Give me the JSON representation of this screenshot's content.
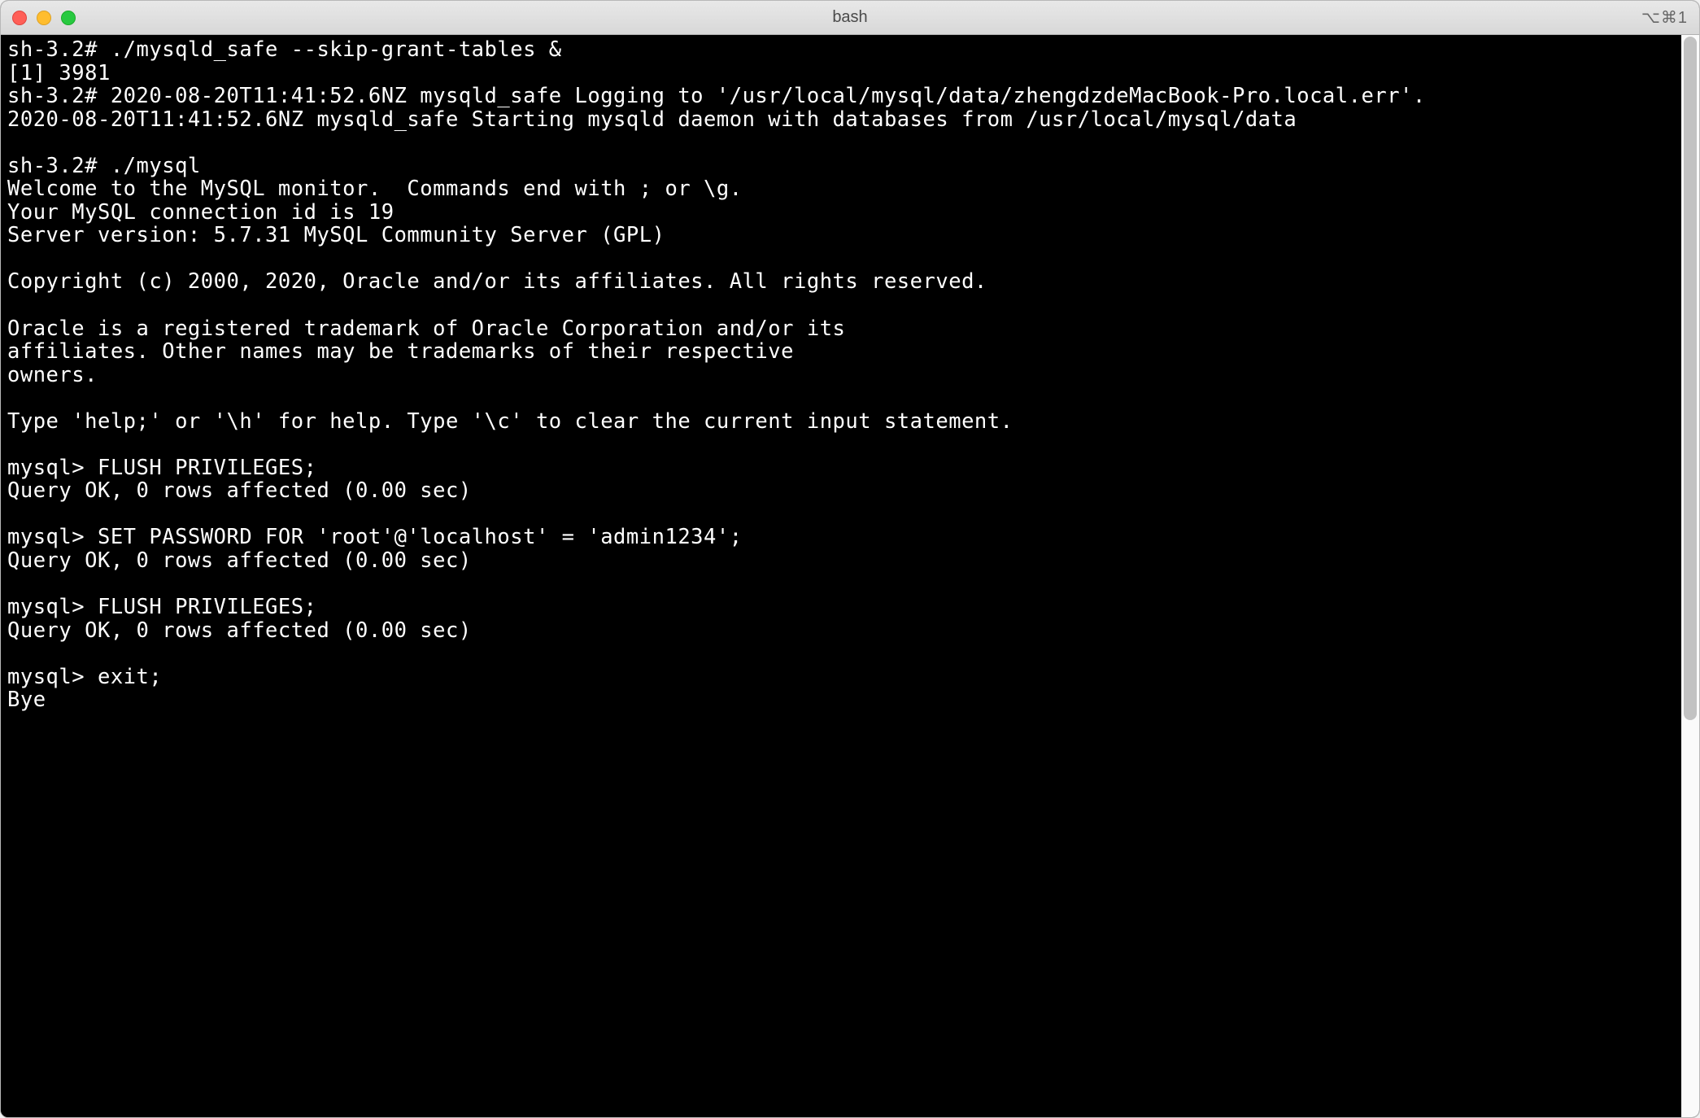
{
  "titlebar": {
    "title": "bash",
    "shortcut": "⌥⌘1"
  },
  "terminal": {
    "lines": [
      "sh-3.2# ./mysqld_safe --skip-grant-tables &",
      "[1] 3981",
      "sh-3.2# 2020-08-20T11:41:52.6NZ mysqld_safe Logging to '/usr/local/mysql/data/zhengdzdeMacBook-Pro.local.err'.",
      "2020-08-20T11:41:52.6NZ mysqld_safe Starting mysqld daemon with databases from /usr/local/mysql/data",
      "",
      "sh-3.2# ./mysql",
      "Welcome to the MySQL monitor.  Commands end with ; or \\g.",
      "Your MySQL connection id is 19",
      "Server version: 5.7.31 MySQL Community Server (GPL)",
      "",
      "Copyright (c) 2000, 2020, Oracle and/or its affiliates. All rights reserved.",
      "",
      "Oracle is a registered trademark of Oracle Corporation and/or its",
      "affiliates. Other names may be trademarks of their respective",
      "owners.",
      "",
      "Type 'help;' or '\\h' for help. Type '\\c' to clear the current input statement.",
      "",
      "mysql> FLUSH PRIVILEGES;",
      "Query OK, 0 rows affected (0.00 sec)",
      "",
      "mysql> SET PASSWORD FOR 'root'@'localhost' = 'admin1234';",
      "Query OK, 0 rows affected (0.00 sec)",
      "",
      "mysql> FLUSH PRIVILEGES;",
      "Query OK, 0 rows affected (0.00 sec)",
      "",
      "mysql> exit;",
      "Bye"
    ]
  }
}
